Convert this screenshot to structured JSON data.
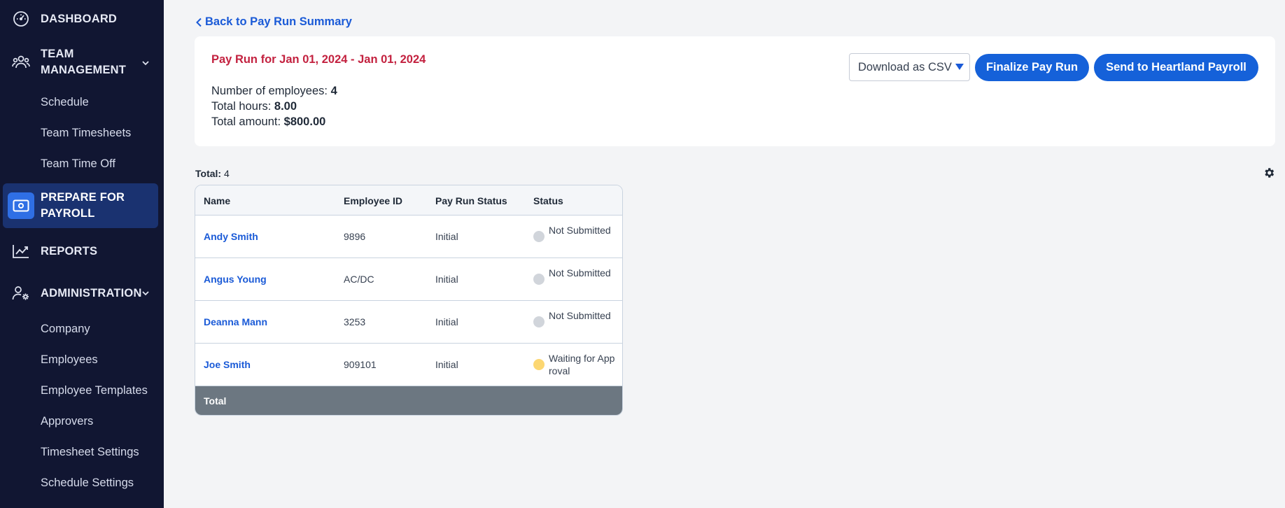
{
  "sidebar": {
    "items": [
      {
        "label": "DASHBOARD",
        "icon": "speedometer-icon"
      },
      {
        "label": "TEAM MANAGEMENT",
        "icon": "team-icon",
        "expanded": true,
        "children": [
          "Schedule",
          "Team Timesheets",
          "Team Time Off"
        ]
      },
      {
        "label": "PREPARE FOR PAYROLL",
        "icon": "money-icon",
        "active": true
      },
      {
        "label": "REPORTS",
        "icon": "chart-line-icon"
      },
      {
        "label": "ADMINISTRATION",
        "icon": "user-gear-icon",
        "expanded": true,
        "children": [
          "Company",
          "Employees",
          "Employee Templates",
          "Approvers",
          "Timesheet Settings",
          "Schedule Settings"
        ]
      }
    ]
  },
  "main": {
    "back_link": "Back to Pay Run Summary",
    "card": {
      "title": "Pay Run for Jan 01, 2024 - Jan 01, 2024",
      "employees_label": "Number of employees:",
      "employees_value": "4",
      "hours_label": "Total hours:",
      "hours_value": "8.00",
      "amount_label": "Total amount:",
      "amount_value": "$800.00"
    },
    "download_select": "Download as CSV",
    "finalize_button": "Finalize Pay Run",
    "send_button": "Send to Heartland Payroll",
    "total_label": "Total:",
    "total_value": "4",
    "table": {
      "columns": [
        "Name",
        "Employee ID",
        "Pay Run Status",
        "Status"
      ],
      "rows": [
        {
          "name": "Andy Smith",
          "employee_id": "9896",
          "pay_run_status": "Initial",
          "status": "Not Submitted",
          "status_color": "#d1d5db"
        },
        {
          "name": "Angus Young",
          "employee_id": "AC/DC",
          "pay_run_status": "Initial",
          "status": "Not Submitted",
          "status_color": "#d1d5db"
        },
        {
          "name": "Deanna Mann",
          "employee_id": "3253",
          "pay_run_status": "Initial",
          "status": "Not Submitted",
          "status_color": "#d1d5db"
        },
        {
          "name": "Joe Smith",
          "employee_id": "909101",
          "pay_run_status": "Initial",
          "status": "Waiting for Approval",
          "status_color": "#fcd772"
        }
      ],
      "footer_label": "Total"
    }
  }
}
